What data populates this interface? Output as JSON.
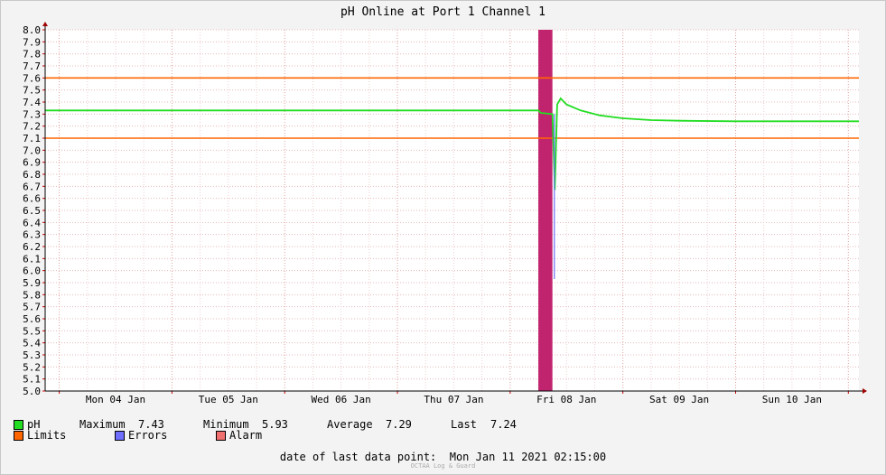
{
  "chart_data": {
    "type": "line",
    "title": "pH Online at Port 1 Channel 1",
    "ylim": [
      5.0,
      8.0
    ],
    "y_ticks": [
      "5.0",
      "5.1",
      "5.2",
      "5.3",
      "5.4",
      "5.5",
      "5.6",
      "5.7",
      "5.8",
      "5.9",
      "6.0",
      "6.1",
      "6.2",
      "6.3",
      "6.4",
      "6.5",
      "6.6",
      "6.7",
      "6.8",
      "6.9",
      "7.0",
      "7.1",
      "7.2",
      "7.3",
      "7.4",
      "7.5",
      "7.6",
      "7.7",
      "7.8",
      "7.9",
      "8.0"
    ],
    "x_range": [
      "2021-01-03 21:00",
      "2021-01-11 02:15"
    ],
    "x_tick_labels": [
      {
        "label": "Mon 04 Jan",
        "t": "2021-01-04 12:00"
      },
      {
        "label": "Tue 05 Jan",
        "t": "2021-01-05 12:00"
      },
      {
        "label": "Wed 06 Jan",
        "t": "2021-01-06 12:00"
      },
      {
        "label": "Thu 07 Jan",
        "t": "2021-01-07 12:00"
      },
      {
        "label": "Fri 08 Jan",
        "t": "2021-01-08 12:00"
      },
      {
        "label": "Sat 09 Jan",
        "t": "2021-01-09 12:00"
      },
      {
        "label": "Sun 10 Jan",
        "t": "2021-01-10 12:00"
      }
    ],
    "grid": true,
    "series": [
      {
        "name": "pH",
        "color": "#22dd22",
        "points": [
          [
            "2021-01-03 21:00",
            7.33
          ],
          [
            "2021-01-05 00:00",
            7.33
          ],
          [
            "2021-01-06 12:00",
            7.33
          ],
          [
            "2021-01-07 12:00",
            7.33
          ],
          [
            "2021-01-08 06:00",
            7.33
          ],
          [
            "2021-01-08 06:30",
            7.31
          ],
          [
            "2021-01-08 09:00",
            7.3
          ],
          [
            "2021-01-08 09:30",
            6.67
          ],
          [
            "2021-01-08 10:00",
            7.38
          ],
          [
            "2021-01-08 10:45",
            7.43
          ],
          [
            "2021-01-08 12:00",
            7.38
          ],
          [
            "2021-01-08 15:00",
            7.33
          ],
          [
            "2021-01-08 19:00",
            7.29
          ],
          [
            "2021-01-09 00:00",
            7.265
          ],
          [
            "2021-01-09 06:00",
            7.25
          ],
          [
            "2021-01-09 12:00",
            7.245
          ],
          [
            "2021-01-10 00:00",
            7.24
          ],
          [
            "2021-01-10 12:00",
            7.24
          ],
          [
            "2021-01-11 00:00",
            7.24
          ],
          [
            "2021-01-11 02:15",
            7.24
          ]
        ]
      },
      {
        "name": "Errors",
        "color": "#6e6eff",
        "points": [
          [
            "2021-01-08 09:25",
            5.93
          ],
          [
            "2021-01-08 09:25",
            7.3
          ]
        ]
      }
    ],
    "limits": {
      "name": "Limits",
      "color": "#ff6600",
      "values": [
        7.6,
        7.1
      ]
    },
    "alarm": {
      "name": "Alarm",
      "color": "#c0246e",
      "range": [
        "2021-01-08 06:00",
        "2021-01-08 09:00"
      ]
    }
  },
  "legend": {
    "ph": {
      "label": "pH",
      "color": "#22dd22"
    },
    "limits": {
      "label": "Limits",
      "color": "#ff6600"
    },
    "errors": {
      "label": "Errors",
      "color": "#6e6eff"
    },
    "alarm": {
      "label": "Alarm",
      "color": "#f07070"
    }
  },
  "stats": {
    "max_label": "Maximum",
    "max_value": "7.43",
    "min_label": "Minimum",
    "min_value": "5.93",
    "avg_label": "Average",
    "avg_value": "7.29",
    "last_label": "Last",
    "last_value": "7.24"
  },
  "footer": {
    "label": "date of last data point:",
    "value": "Mon Jan 11 2021 02:15:00"
  },
  "branding": "OCTAA Log & Guard"
}
